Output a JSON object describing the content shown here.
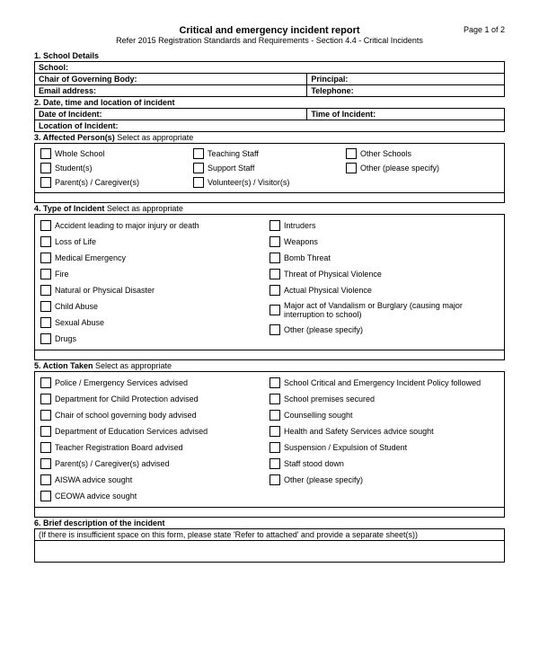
{
  "header": {
    "title": "Critical and emergency incident report",
    "subtitle": "Refer 2015 Registration Standards and Requirements - Section 4.4 - Critical Incidents",
    "page_indicator": "Page 1 of 2"
  },
  "s1": {
    "heading": "1.  School Details",
    "school_label": "School:",
    "chair_label": "Chair of Governing Body:",
    "principal_label": "Principal:",
    "email_label": "Email address:",
    "telephone_label": "Telephone:"
  },
  "s2": {
    "heading": "2.  Date, time and location of incident",
    "date_label": "Date of Incident:",
    "time_label": "Time of Incident:",
    "location_label": "Location of Incident:"
  },
  "s3": {
    "heading": "3.  Affected Person(s) ",
    "hint": "Select as appropriate",
    "col1": [
      "Whole School",
      "Student(s)",
      "Parent(s) / Caregiver(s)"
    ],
    "col2": [
      "Teaching Staff",
      "Support Staff",
      "Volunteer(s) / Visitor(s)"
    ],
    "col3": [
      "Other Schools",
      "Other (please specify)"
    ]
  },
  "s4": {
    "heading": "4.  Type of Incident ",
    "hint": "Select as appropriate",
    "col1": [
      "Accident leading to major injury or death",
      "Loss of Life",
      "Medical Emergency",
      "Fire",
      "Natural or Physical Disaster",
      "Child Abuse",
      "Sexual Abuse",
      "Drugs"
    ],
    "col2": [
      "Intruders",
      "Weapons",
      "Bomb Threat",
      "Threat of Physical Violence",
      "Actual Physical Violence",
      "Major act of Vandalism or Burglary (causing major interruption to school)",
      "Other (please specify)"
    ]
  },
  "s5": {
    "heading": "5.  Action Taken ",
    "hint": "Select as appropriate",
    "col1": [
      "Police / Emergency Services advised",
      "Department for Child Protection advised",
      "Chair of school governing body advised",
      "Department of Education Services advised",
      "Teacher Registration Board advised",
      "Parent(s) / Caregiver(s) advised",
      "AISWA advice sought",
      "CEOWA advice sought"
    ],
    "col2": [
      "School Critical and Emergency Incident Policy followed",
      "School premises secured",
      "Counselling sought",
      "Health and Safety Services advice sought",
      "Suspension / Expulsion of Student",
      "Staff stood down",
      "Other (please specify)"
    ]
  },
  "s6": {
    "heading": "6.  Brief description of the incident",
    "note": "(If there is insufficient space on this form, please state 'Refer to attached' and provide a separate sheet(s))"
  }
}
